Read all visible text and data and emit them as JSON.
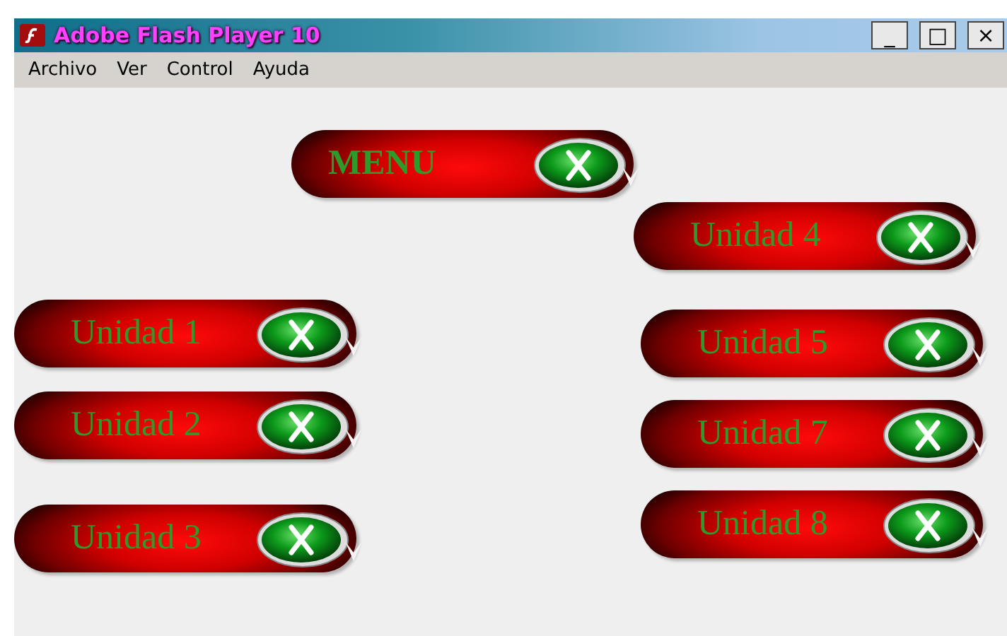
{
  "window": {
    "title": "Adobe Flash Player 10",
    "controls": [
      "_",
      "□",
      "×"
    ]
  },
  "menu": [
    "Archivo",
    "Ver",
    "Control",
    "Ayuda"
  ],
  "stage": {
    "buttons": [
      {
        "label": "MENU",
        "kind": "menu"
      },
      {
        "label": "Unidad 4",
        "kind": "unit"
      },
      {
        "label": "Unidad 1",
        "kind": "unit"
      },
      {
        "label": "Unidad 5",
        "kind": "unit"
      },
      {
        "label": "Unidad 2",
        "kind": "unit"
      },
      {
        "label": "Unidad 7",
        "kind": "unit"
      },
      {
        "label": "Unidad 3",
        "kind": "unit"
      },
      {
        "label": "Unidad 8",
        "kind": "unit"
      }
    ]
  }
}
